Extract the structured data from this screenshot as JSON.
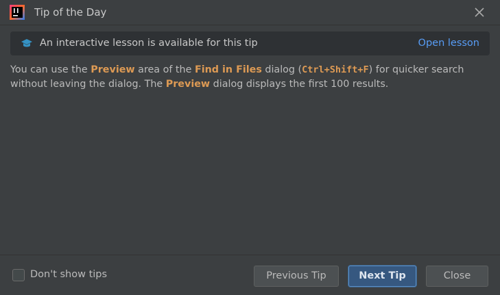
{
  "window": {
    "title": "Tip of the Day",
    "app_icon": "intellij-idea-icon",
    "close_icon": "close-icon"
  },
  "lesson_banner": {
    "icon": "graduation-cap-icon",
    "text": "An interactive lesson is available for this tip",
    "link_label": "Open lesson"
  },
  "tip": {
    "segments": [
      {
        "text": "You can use the ",
        "style": "plain"
      },
      {
        "text": "Preview",
        "style": "highlight"
      },
      {
        "text": " area of the ",
        "style": "plain"
      },
      {
        "text": "Find in Files",
        "style": "highlight"
      },
      {
        "text": " dialog (",
        "style": "plain"
      },
      {
        "text": "Ctrl+Shift+F",
        "style": "shortcut"
      },
      {
        "text": ") for quicker search without leaving the dialog. The ",
        "style": "plain"
      },
      {
        "text": "Preview",
        "style": "highlight"
      },
      {
        "text": " dialog displays the first 100 results.",
        "style": "plain"
      }
    ]
  },
  "footer": {
    "checkbox_label": "Don't show tips",
    "checkbox_checked": false,
    "prev_label": "Previous Tip",
    "next_label": "Next Tip",
    "close_label": "Close"
  },
  "colors": {
    "background": "#3c3f41",
    "highlight": "#dd9a54",
    "link": "#589df6",
    "primary_button": "#365880"
  }
}
